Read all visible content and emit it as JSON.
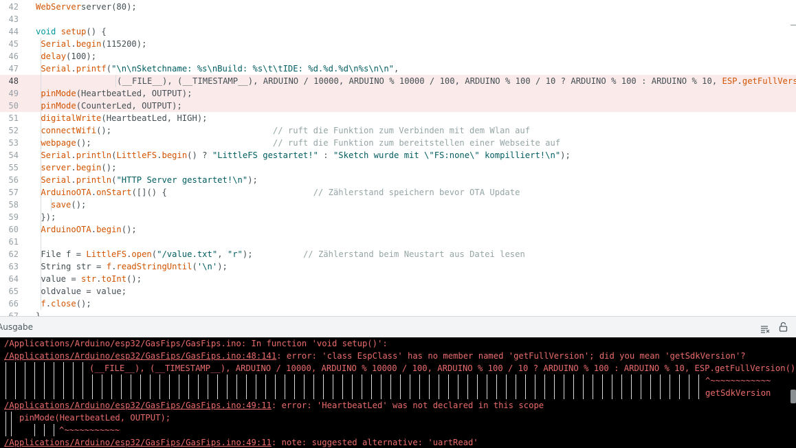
{
  "editor": {
    "lines": [
      {
        "n": "42",
        "segs": [
          [
            "fn",
            "WebServer"
          ],
          [
            "",
            "server"
          ],
          [
            "",
            ""
          ],
          [
            "fn",
            ""
          ],
          [
            "",
            "(80);"
          ]
        ]
      },
      {
        "n": "43",
        "segs": []
      },
      {
        "n": "44",
        "segs": [
          [
            "kw",
            "void"
          ],
          [
            "",
            " "
          ],
          [
            "fn",
            "setup"
          ],
          [
            "",
            "() {"
          ]
        ]
      },
      {
        "n": "45",
        "segs": [
          [
            "",
            " "
          ],
          [
            "fn",
            "Serial"
          ],
          [
            "",
            "."
          ],
          [
            "fn",
            "begin"
          ],
          [
            "",
            "(115200);"
          ]
        ]
      },
      {
        "n": "46",
        "segs": [
          [
            "",
            " "
          ],
          [
            "fn",
            "delay"
          ],
          [
            "",
            "(100);"
          ]
        ]
      },
      {
        "n": "47",
        "segs": [
          [
            "",
            " "
          ],
          [
            "fn",
            "Serial"
          ],
          [
            "",
            "."
          ],
          [
            "fn",
            "printf"
          ],
          [
            "",
            "("
          ],
          [
            "str",
            "\"\\n\\nSketchname: %s\\nBuild: %s\\t\\tIDE: %d.%d.%d\\n%s\\n\\n\""
          ],
          [
            "",
            ","
          ]
        ]
      },
      {
        "n": "48",
        "segs": [
          [
            "",
            "(__FILE__), (__TIMESTAMP__), ARDUINO / 10000, ARDUINO % 10000 / 100, ARDUINO % 100 / 10 ? ARDUINO % 100 : ARDUINO % 10, "
          ],
          [
            "fn",
            "ESP"
          ],
          [
            "",
            "."
          ],
          [
            "fn",
            "getFullVersio"
          ]
        ]
      },
      {
        "n": "49",
        "segs": [
          [
            "",
            " "
          ],
          [
            "fn",
            "pinMode"
          ],
          [
            "",
            "(HeartbeatLed, OUTPUT);"
          ]
        ]
      },
      {
        "n": "50",
        "segs": [
          [
            "",
            " "
          ],
          [
            "fn",
            "pinMode"
          ],
          [
            "",
            "(CounterLed, OUTPUT);"
          ]
        ]
      },
      {
        "n": "51",
        "segs": [
          [
            "",
            " "
          ],
          [
            "fn",
            "digitalWrite"
          ],
          [
            "",
            "(HeartbeatLed, HIGH);"
          ]
        ]
      },
      {
        "n": "52",
        "segs": [
          [
            "",
            " "
          ],
          [
            "fn",
            "connectWifi"
          ],
          [
            "",
            "();                                "
          ],
          [
            "cmt",
            "// ruft die Funktion zum Verbinden mit dem Wlan auf"
          ]
        ]
      },
      {
        "n": "53",
        "segs": [
          [
            "",
            " "
          ],
          [
            "fn",
            "webpage"
          ],
          [
            "",
            "();                                    "
          ],
          [
            "cmt",
            "// ruft die Funktion zum bereitstellen einer Webseite auf"
          ]
        ]
      },
      {
        "n": "54",
        "segs": [
          [
            "",
            " "
          ],
          [
            "fn",
            "Serial"
          ],
          [
            "",
            "."
          ],
          [
            "fn",
            "println"
          ],
          [
            "",
            "("
          ],
          [
            "fn",
            "LittleFS"
          ],
          [
            "",
            "."
          ],
          [
            "fn",
            "begin"
          ],
          [
            "",
            "() ? "
          ],
          [
            "str",
            "\"LittleFS gestartet!\""
          ],
          [
            "",
            " : "
          ],
          [
            "str",
            "\"Sketch wurde mit \\\"FS:none\\\" kompilliert!\\n\""
          ],
          [
            "",
            ");"
          ]
        ]
      },
      {
        "n": "55",
        "segs": [
          [
            "",
            " "
          ],
          [
            "fn",
            "server"
          ],
          [
            "",
            "."
          ],
          [
            "fn",
            "begin"
          ],
          [
            "",
            "();"
          ]
        ]
      },
      {
        "n": "56",
        "segs": [
          [
            "",
            " "
          ],
          [
            "fn",
            "Serial"
          ],
          [
            "",
            "."
          ],
          [
            "fn",
            "println"
          ],
          [
            "",
            "("
          ],
          [
            "str",
            "\"HTTP Server gestartet!\\n\""
          ],
          [
            "",
            ");"
          ]
        ]
      },
      {
        "n": "57",
        "segs": [
          [
            "",
            " "
          ],
          [
            "fn",
            "ArduinoOTA"
          ],
          [
            "",
            "."
          ],
          [
            "fn",
            "onStart"
          ],
          [
            "",
            "([]() {                             "
          ],
          [
            "cmt",
            "// Zählerstand speichern bevor OTA Update"
          ]
        ]
      },
      {
        "n": "58",
        "segs": [
          [
            "",
            "   "
          ],
          [
            "fn",
            "save"
          ],
          [
            "",
            "();"
          ]
        ]
      },
      {
        "n": "59",
        "segs": [
          [
            "",
            " });"
          ]
        ]
      },
      {
        "n": "60",
        "segs": [
          [
            "",
            " "
          ],
          [
            "fn",
            "ArduinoOTA"
          ],
          [
            "",
            "."
          ],
          [
            "fn",
            "begin"
          ],
          [
            "",
            "();"
          ]
        ]
      },
      {
        "n": "61",
        "segs": []
      },
      {
        "n": "62",
        "segs": [
          [
            "",
            " File f = "
          ],
          [
            "fn",
            "LittleFS"
          ],
          [
            "",
            "."
          ],
          [
            "fn",
            "open"
          ],
          [
            "",
            "("
          ],
          [
            "str",
            "\"/value.txt\""
          ],
          [
            "",
            ", "
          ],
          [
            "str",
            "\"r\""
          ],
          [
            "",
            ");          "
          ],
          [
            "cmt",
            "// Zählerstand beim Neustart aus Datei lesen"
          ]
        ]
      },
      {
        "n": "63",
        "segs": [
          [
            "",
            " String str = "
          ],
          [
            "fn",
            "f"
          ],
          [
            "",
            "."
          ],
          [
            "fn",
            "readStringUntil"
          ],
          [
            "",
            "("
          ],
          [
            "str",
            "'\\n'"
          ],
          [
            "",
            ");"
          ]
        ]
      },
      {
        "n": "64",
        "segs": [
          [
            "",
            " value = "
          ],
          [
            "fn",
            "str"
          ],
          [
            "",
            "."
          ],
          [
            "fn",
            "toInt"
          ],
          [
            "",
            "();"
          ]
        ]
      },
      {
        "n": "65",
        "segs": [
          [
            "",
            " oldvalue = value;"
          ]
        ]
      },
      {
        "n": "66",
        "segs": [
          [
            "",
            " "
          ],
          [
            "fn",
            "f"
          ],
          [
            "",
            "."
          ],
          [
            "fn",
            "close"
          ],
          [
            "",
            "();"
          ]
        ]
      },
      {
        "n": "67",
        "segs": [
          [
            "",
            "}"
          ]
        ]
      }
    ]
  },
  "output": {
    "title": "Ausgabe",
    "clear_icon": "clear-output-icon",
    "lock_icon": "scroll-lock-icon",
    "lines": [
      {
        "prefix": "",
        "path": "/Applications/Arduino/esp32/GasFips/GasFips.ino",
        "text": ": In function 'void setup()':",
        "underline": false
      },
      {
        "prefix": "",
        "path": "/Applications/Arduino/esp32/GasFips/GasFips.ino:48:141",
        "text": ": error: 'class EspClass' has no member named 'getFullVersion'; did you mean 'getSdkVersion'?",
        "underline": true
      },
      {
        "prefix": "",
        "path": "",
        "text": "(__FILE__), (__TIMESTAMP__), ARDUINO / 10000, ARDUINO % 10000 / 100, ARDUINO % 100 / 10 ? ARDUINO % 100 : ARDUINO % 10, ESP.getFullVersion().c_",
        "underline": false
      },
      {
        "prefix": "",
        "path": "",
        "text": "^~~~~~~~~~~~~",
        "underline": false
      },
      {
        "prefix": "",
        "path": "",
        "text": "getSdkVersion",
        "underline": false
      },
      {
        "prefix": "",
        "path": "/Applications/Arduino/esp32/GasFips/GasFips.ino:49:11",
        "text": ": error: 'HeartbeatLed' was not declared in this scope",
        "underline": true
      },
      {
        "prefix": "",
        "path": "",
        "text": "pinMode(HeartbeatLed, OUTPUT);",
        "underline": false
      },
      {
        "prefix": "",
        "path": "",
        "text": "^~~~~~~~~~~~",
        "underline": false
      },
      {
        "prefix": "",
        "path": "/Applications/Arduino/esp32/GasFips/GasFips.ino:49:11",
        "text": ": note: suggested alternative: 'uartRead'",
        "underline": true
      }
    ]
  },
  "colors": {
    "keyword": "#00979c",
    "function": "#d35400",
    "string": "#005c5f",
    "comment": "#95a5a6",
    "error_text": "#ea6b6b",
    "error_line_bg": "#fbeaea",
    "console_bg": "#000000"
  }
}
